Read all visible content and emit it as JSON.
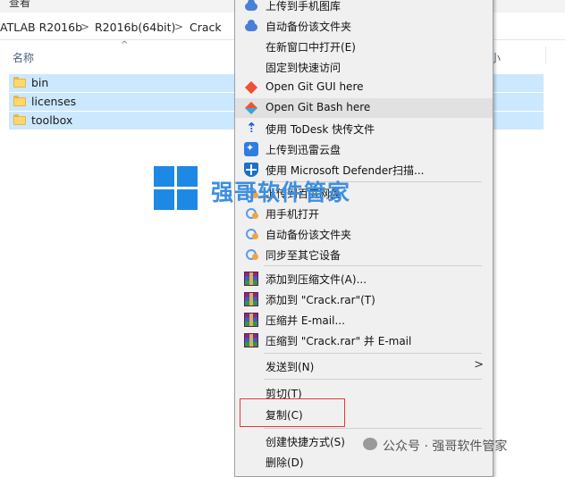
{
  "toolbar": {
    "view_label": "查看"
  },
  "breadcrumb": {
    "items": [
      "ATLAB R2016b",
      "R2016b(64bit)",
      "Crack"
    ],
    "separator": ">"
  },
  "columns": {
    "name": "名称",
    "size": "小"
  },
  "files": [
    {
      "name": "bin",
      "icon": "folder-icon"
    },
    {
      "name": "licenses",
      "icon": "folder-icon"
    },
    {
      "name": "toolbox",
      "icon": "folder-icon"
    }
  ],
  "watermark": {
    "text": "强哥软件管家"
  },
  "context_menu": {
    "items": [
      {
        "id": "upload-pictures",
        "label": "上传到手机图库",
        "icon": "cloud-icon"
      },
      {
        "id": "auto-backup",
        "label": "自动备份该文件夹",
        "icon": "cloud-icon"
      },
      {
        "id": "open-new-window",
        "label": "在新窗口中打开(E)",
        "icon": ""
      },
      {
        "id": "pin-quick-access",
        "label": "固定到快速访问",
        "icon": ""
      },
      {
        "id": "git-gui",
        "label": "Open Git GUI here",
        "icon": "git-icon"
      },
      {
        "id": "git-bash",
        "label": "Open Git Bash here",
        "icon": "git-bash-icon"
      },
      {
        "id": "todesk",
        "label": "使用 ToDesk 快传文件",
        "icon": "todesk-icon"
      },
      {
        "id": "xunlei",
        "label": "上传到迅雷云盘",
        "icon": "xunlei-icon"
      },
      {
        "id": "defender",
        "label": "使用 Microsoft Defender扫描...",
        "icon": "defender-icon"
      },
      {
        "id": "baidu-upload",
        "label": "上传到百度网盘",
        "icon": "baidu-icon"
      },
      {
        "id": "baidu-phone",
        "label": "用手机打开",
        "icon": "baidu-icon"
      },
      {
        "id": "baidu-backup",
        "label": "自动备份该文件夹",
        "icon": "baidu-icon"
      },
      {
        "id": "baidu-sync",
        "label": "同步至其它设备",
        "icon": "baidu-icon"
      },
      {
        "id": "rar-add",
        "label": "添加到压缩文件(A)...",
        "icon": "winrar-icon"
      },
      {
        "id": "rar-add-named",
        "label": "添加到 \"Crack.rar\"(T)",
        "icon": "winrar-icon"
      },
      {
        "id": "rar-email",
        "label": "压缩并 E-mail...",
        "icon": "winrar-icon"
      },
      {
        "id": "rar-named-email",
        "label": "压缩到 \"Crack.rar\" 并 E-mail",
        "icon": "winrar-icon"
      },
      {
        "id": "send-to",
        "label": "发送到(N)",
        "icon": "",
        "submenu": ">"
      },
      {
        "id": "cut",
        "label": "剪切(T)",
        "icon": ""
      },
      {
        "id": "copy",
        "label": "复制(C)",
        "icon": ""
      },
      {
        "id": "create-shortcut",
        "label": "创建快捷方式(S)",
        "icon": ""
      },
      {
        "id": "delete",
        "label": "删除(D)",
        "icon": ""
      }
    ]
  },
  "footer_watermark": {
    "text": "公众号 · 强哥软件管家"
  },
  "colors": {
    "selection": "#cce8ff",
    "menu_bg": "#f0f0f0",
    "highlight_box": "#e53935",
    "accent": "#1e88e5"
  }
}
